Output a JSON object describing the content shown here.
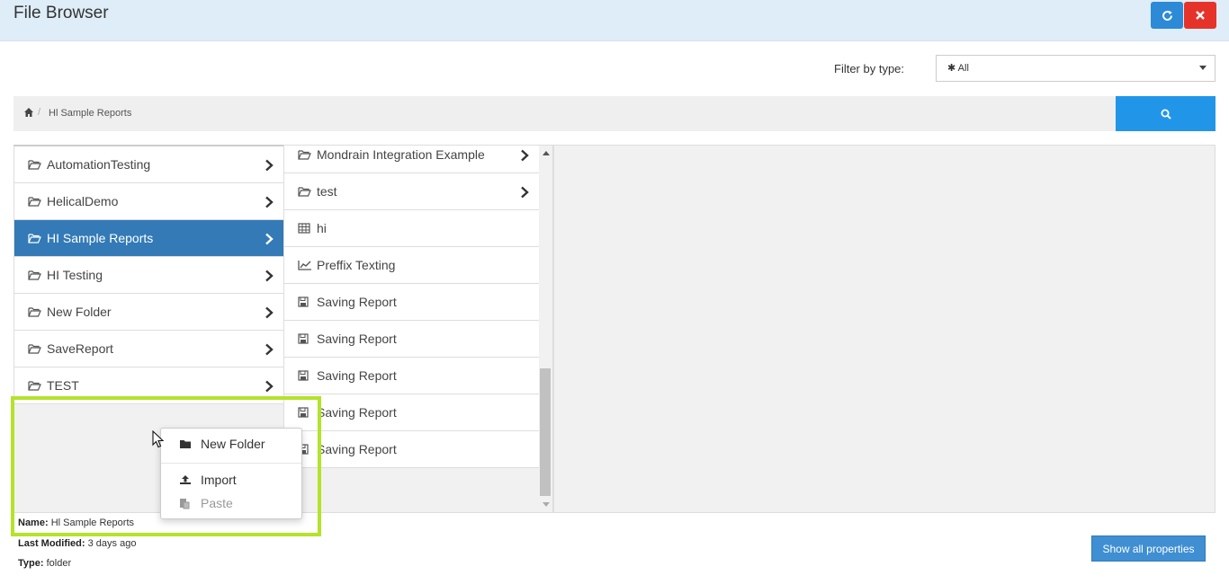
{
  "app": {
    "title": "File Browser"
  },
  "toolbar": {
    "refresh_icon": "refresh-icon",
    "close_icon": "close-icon"
  },
  "filter": {
    "label": "Filter by type:",
    "selected": "✱ All"
  },
  "breadcrumb": {
    "separator": "/",
    "items": [
      "Hl Sample Reports"
    ]
  },
  "left_pane": {
    "items": [
      {
        "label": "AutomationTesting",
        "icon": "folder-open-icon",
        "selected": false
      },
      {
        "label": "HelicalDemo",
        "icon": "folder-open-icon",
        "selected": false
      },
      {
        "label": "HI Sample Reports",
        "icon": "folder-open-icon",
        "selected": true
      },
      {
        "label": "HI Testing",
        "icon": "folder-open-icon",
        "selected": false
      },
      {
        "label": "New Folder",
        "icon": "folder-open-icon",
        "selected": false
      },
      {
        "label": "SaveReport",
        "icon": "folder-open-icon",
        "selected": false
      },
      {
        "label": "TEST",
        "icon": "folder-open-icon",
        "selected": false
      }
    ]
  },
  "mid_pane": {
    "items": [
      {
        "label": "Mondrain Integration Example",
        "icon": "folder-open-icon",
        "folder": true
      },
      {
        "label": "test",
        "icon": "folder-open-icon",
        "folder": true
      },
      {
        "label": "hi",
        "icon": "table-icon",
        "folder": false
      },
      {
        "label": "Preffix Texting",
        "icon": "line-chart-icon",
        "folder": false
      },
      {
        "label": "Saving Report",
        "icon": "save-icon",
        "folder": false
      },
      {
        "label": "Saving Report",
        "icon": "save-icon",
        "folder": false
      },
      {
        "label": "Saving Report",
        "icon": "save-icon",
        "folder": false
      },
      {
        "label": "Saving Report",
        "icon": "save-icon",
        "folder": false
      },
      {
        "label": "Saving Report",
        "icon": "save-icon",
        "folder": false
      }
    ]
  },
  "context_menu": {
    "items": [
      {
        "label": "New Folder",
        "icon": "folder-icon",
        "enabled": true
      },
      {
        "label": "Import",
        "icon": "upload-icon",
        "enabled": true
      },
      {
        "label": "Paste",
        "icon": "paste-icon",
        "enabled": false
      }
    ]
  },
  "properties": {
    "name_label": "Name:",
    "name_value": "Hl Sample Reports",
    "modified_label": "Last Modified:",
    "modified_value": "3 days ago",
    "type_label": "Type:",
    "type_value": "folder"
  },
  "show_all_label": "Show all properties",
  "colors": {
    "selected": "#337ab7",
    "highlight": "#b5e22a",
    "search_button": "#2196e8",
    "close_button": "#e6332a"
  }
}
